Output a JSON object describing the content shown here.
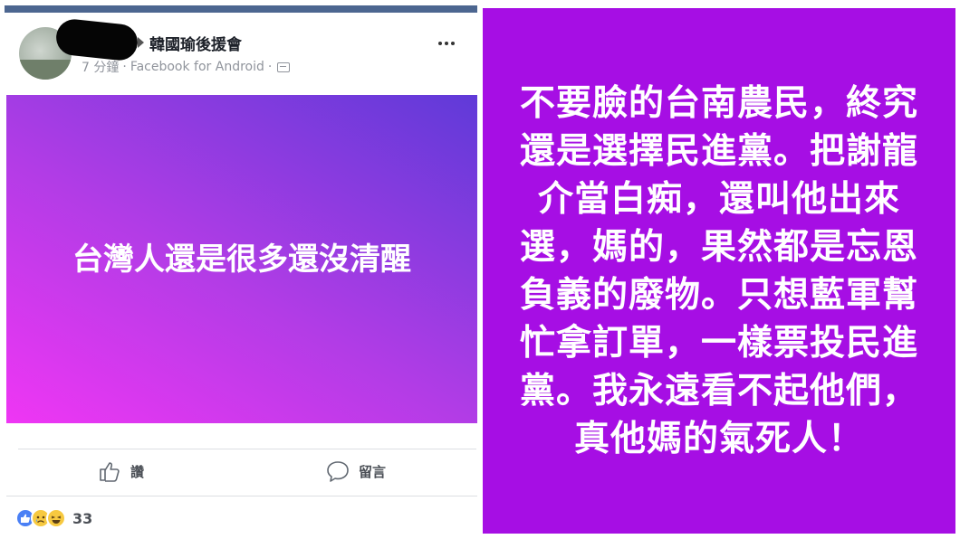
{
  "post": {
    "group_name": "韓國瑜後援會",
    "time": "7 分鐘",
    "source": "Facebook for Android",
    "separator": "·",
    "text": "台灣人還是很多還沒清醒"
  },
  "actions": {
    "like_label": "讚",
    "comment_label": "留言"
  },
  "reactions": {
    "types": [
      "like",
      "sad",
      "haha"
    ],
    "count": "33"
  },
  "quote": {
    "text": "不要臉的台南農民，終究還是選擇民進黨。把謝龍介當白痴，還叫他出來選，媽的，果然都是忘恩負義的廢物。只想藍軍幫忙拿訂單，一樣票投民進黨。我永遠看不起他們，真他媽的氣死人！"
  },
  "colors": {
    "post_gradient_start": "#ef36f4",
    "post_gradient_end": "#5f3ad8",
    "quote_background": "#a60ee4",
    "top_bar": "#4c6690"
  },
  "icons": {
    "arrow": "right-triangle-icon",
    "more": "more-options-icon",
    "privacy": "privacy-icon",
    "like": "thumbs-up-icon",
    "comment": "speech-bubble-icon"
  }
}
